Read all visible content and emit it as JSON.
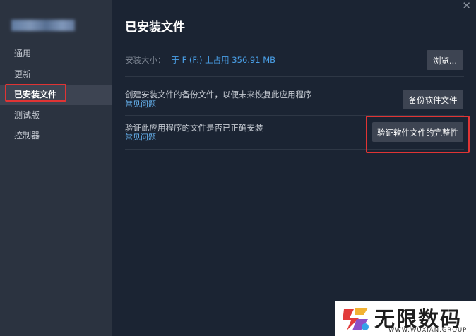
{
  "sidebar": {
    "items": [
      {
        "label": "通用"
      },
      {
        "label": "更新"
      },
      {
        "label": "已安装文件"
      },
      {
        "label": "测试版"
      },
      {
        "label": "控制器"
      }
    ]
  },
  "main": {
    "title": "已安装文件",
    "install_size": {
      "label": "安装大小：",
      "value": "于 F (F:) 上占用 356.91 MB",
      "button": "浏览..."
    },
    "backup": {
      "text": "创建安装文件的备份文件，以便未来恢复此应用程序",
      "link": "常见问题",
      "button": "备份软件文件"
    },
    "verify": {
      "text": "验证此应用程序的文件是否已正确安装",
      "link": "常见问题",
      "button": "验证软件文件的完整性"
    }
  },
  "watermark": {
    "title": "无限数码",
    "subtitle": "WWW.WUXIAN.GROUP"
  },
  "colors": {
    "accent_link": "#67b3f0",
    "highlight_border": "#e03434",
    "panel_bg": "#1b2433",
    "sidebar_bg": "#2b3340"
  },
  "icons": {
    "close": "close-icon",
    "logo": "wuxian-logo-icon"
  }
}
